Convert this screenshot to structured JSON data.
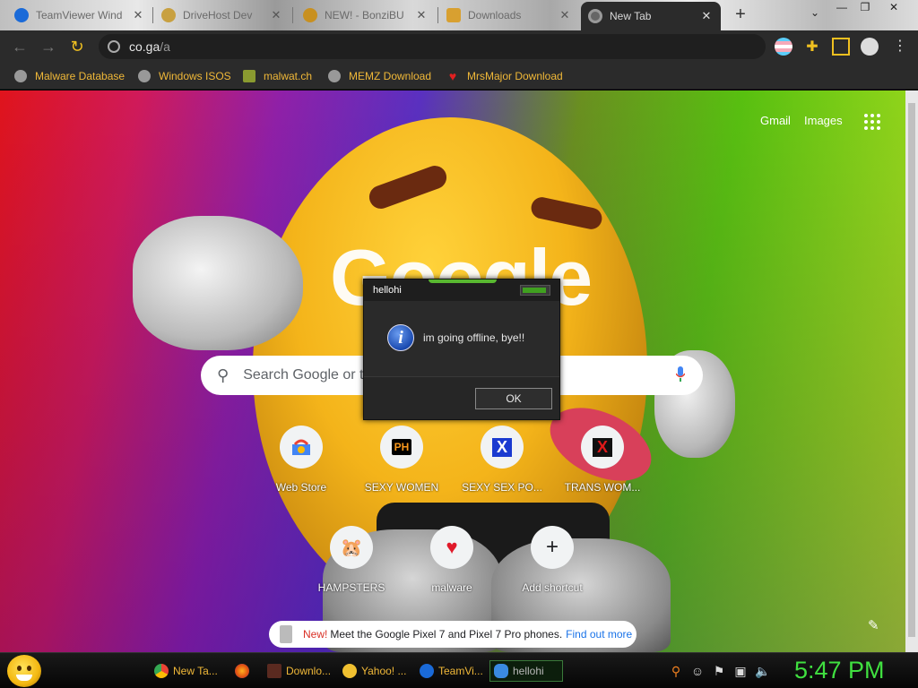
{
  "tabs": [
    {
      "label": "TeamViewer Wind",
      "active": false
    },
    {
      "label": "DriveHost Dev",
      "active": false
    },
    {
      "label": "NEW! - BonziBU",
      "active": false
    },
    {
      "label": "Downloads",
      "active": false
    },
    {
      "label": "New Tab",
      "active": true
    }
  ],
  "toolbar": {
    "url_host": "co.ga",
    "url_path": "/a"
  },
  "bookmarks": [
    {
      "label": "Malware Database"
    },
    {
      "label": "Windows ISOS"
    },
    {
      "label": "malwat.ch"
    },
    {
      "label": "MEMZ Download"
    },
    {
      "label": "MrsMajor Download"
    }
  ],
  "ntp": {
    "logo": "Google",
    "gmail": "Gmail",
    "images": "Images",
    "search_placeholder": "Search Google or type a URL",
    "shortcuts": [
      {
        "label": "Web Store",
        "icon": "chrome-webstore-icon",
        "glyph": ""
      },
      {
        "label": "SEXY WOMEN",
        "icon": "ph-icon",
        "glyph": "PH"
      },
      {
        "label": "SEXY SEX PO...",
        "icon": "blue-x-icon",
        "glyph": "X"
      },
      {
        "label": "TRANS WOM...",
        "icon": "red-x-icon",
        "glyph": "X"
      },
      {
        "label": "HAMPSTERS",
        "icon": "hamster-icon",
        "glyph": "🐹"
      },
      {
        "label": "malware",
        "icon": "heart-icon",
        "glyph": "♥"
      },
      {
        "label": "Add shortcut",
        "icon": "plus-icon",
        "glyph": "+"
      }
    ],
    "promo": {
      "new": "New!",
      "text": "Meet the Google Pixel 7 and Pixel 7 Pro phones.",
      "link": "Find out more"
    }
  },
  "dialog": {
    "title": "hellohi",
    "message": "im going offline, bye!!",
    "ok_label": "OK"
  },
  "taskbar": {
    "items": [
      {
        "label": "New Ta..."
      },
      {
        "label": ""
      },
      {
        "label": "Downlo..."
      },
      {
        "label": "Yahoo! ..."
      },
      {
        "label": "TeamVi..."
      },
      {
        "label": "hellohi"
      }
    ],
    "clock": "5:47 PM"
  },
  "colors": {
    "bookmark_text": "#f0b838",
    "clock": "#40e040",
    "toolbar": "#2b2b2b"
  }
}
